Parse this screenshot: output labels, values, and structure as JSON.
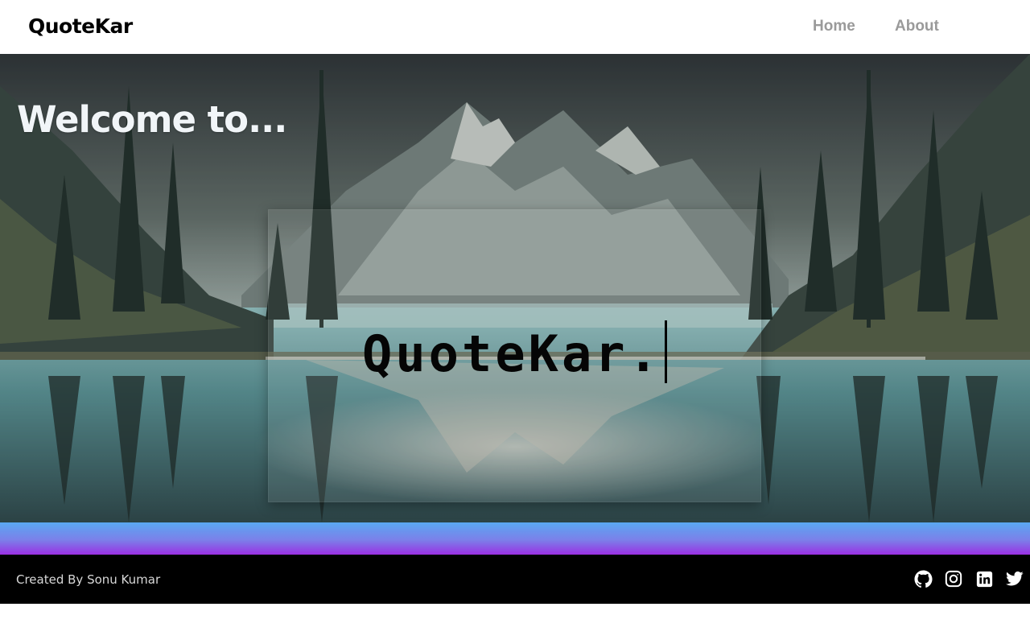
{
  "header": {
    "brand": "QuoteKar",
    "nav": [
      {
        "label": "Home"
      },
      {
        "label": "About"
      }
    ]
  },
  "hero": {
    "welcome": "Welcome to...",
    "typed_text": "QuoteKar."
  },
  "footer": {
    "credit": "Created By Sonu Kumar",
    "social": [
      {
        "icon": "github-icon"
      },
      {
        "icon": "instagram-icon"
      },
      {
        "icon": "linkedin-icon"
      },
      {
        "icon": "twitter-icon"
      }
    ]
  },
  "colors": {
    "nav_text": "#9a9a9a",
    "band_top": "#5aa8f2",
    "band_bottom": "#9a2fe3",
    "footer_bg": "#000000"
  }
}
